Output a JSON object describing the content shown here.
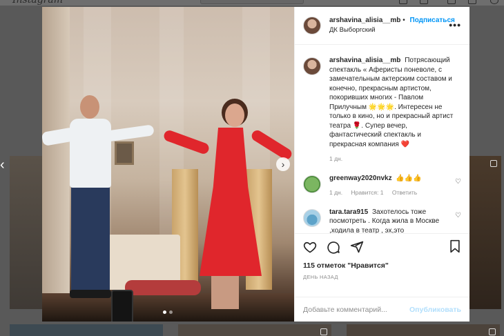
{
  "post": {
    "author": "arshavina_alisia__mb",
    "follow_label": "Подписаться",
    "location": "ДК Выборгский",
    "more_label": "•••",
    "caption": {
      "username": "arshavina_alisia__mb",
      "text": "Потрясающий спектакль « Аферисты поневоле, с замечательным актерским составом и конечно, прекрасным артистом, покоривших многих - Павлом Прилучным 🌟🌟🌟. Интересен не только в кино, но и прекрасный артист театра 🌹. Супер вечер, фантастический спектакль и прекрасная компания ❤️",
      "time": "1 дн."
    },
    "comments": [
      {
        "username": "greenway2020nvkz",
        "text": "👍👍👍",
        "time": "1 дн.",
        "likes": "Нравится: 1",
        "reply": "Ответить"
      },
      {
        "username": "tara.tara915",
        "text": "Захотелось тоже посмотреть . Когда жила в Москве ,ходила в театр , эх,это",
        "time": "",
        "likes": "",
        "reply": ""
      }
    ],
    "likes_text": "115 отметок \"Нравится\"",
    "date_text": "ДЕНЬ НАЗАД",
    "comment_placeholder": "Добавьте комментарий...",
    "publish_label": "Опубликовать",
    "carousel": {
      "count": 2,
      "active_index": 0
    }
  },
  "background": {
    "logo_text": "Instagram"
  },
  "icons": [
    "heart-icon",
    "comment-icon",
    "share-icon",
    "bookmark-icon",
    "chevron-right-icon",
    "chevron-left-icon",
    "more-icon"
  ]
}
